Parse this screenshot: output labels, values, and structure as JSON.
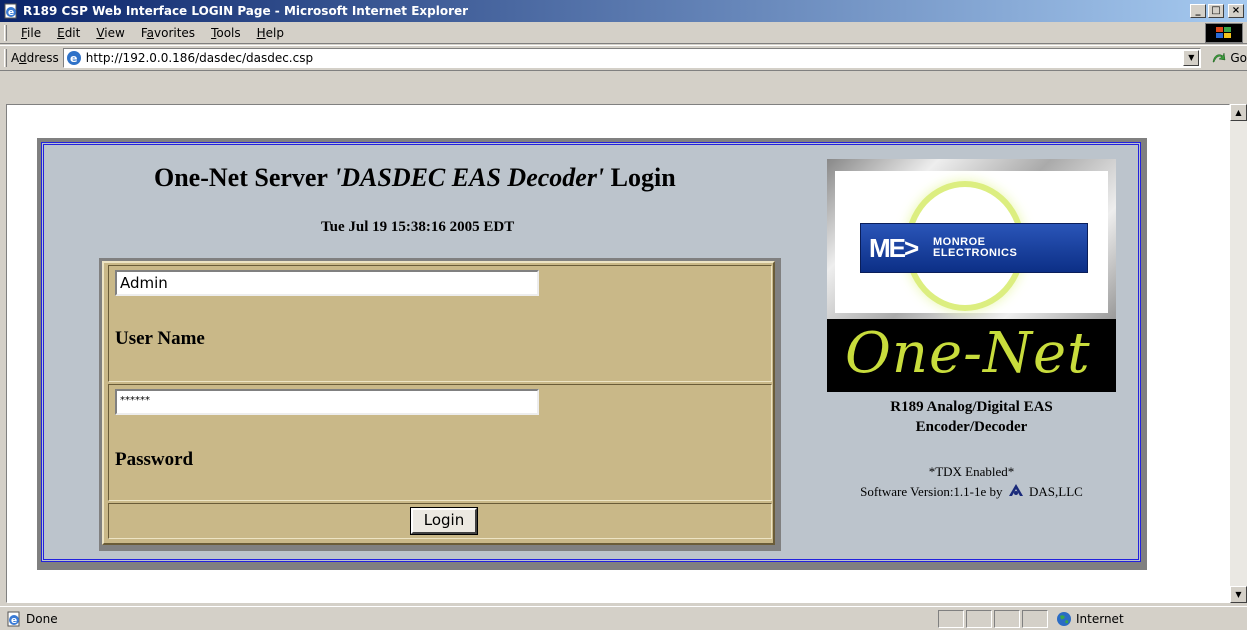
{
  "window": {
    "title": "R189 CSP Web Interface LOGIN Page - Microsoft Internet Explorer",
    "minimize": "_",
    "maximize": "□",
    "close": "×"
  },
  "menu": {
    "items": [
      {
        "key": "F",
        "rest": "ile"
      },
      {
        "key": "E",
        "rest": "dit"
      },
      {
        "key": "V",
        "rest": "iew"
      },
      {
        "pre": "F",
        "key": "a",
        "rest": "vorites"
      },
      {
        "key": "T",
        "rest": "ools"
      },
      {
        "key": "H",
        "rest": "elp"
      }
    ]
  },
  "address": {
    "label_pre": "A",
    "label_key": "d",
    "label_rest": "dress",
    "url": "http://192.0.0.186/dasdec/dasdec.csp",
    "go_label": "Go"
  },
  "page": {
    "heading_plain": "One-Net Server ",
    "heading_italic": "'DASDEC EAS Decoder'",
    "heading_end": " Login",
    "datetime": "Tue Jul 19 15:38:16 2005 EDT",
    "form": {
      "username_value": "Admin",
      "username_label": "User Name",
      "password_value": "******",
      "password_label": "Password",
      "login_label": "Login"
    },
    "logo": {
      "monroe_line1": "MONROE",
      "monroe_line2": "ELECTRONICS",
      "me_mark": "ME>",
      "onenet": "One-Net"
    },
    "product_line1": "R189 Analog/Digital EAS",
    "product_line2": "Encoder/Decoder",
    "tdx": "*TDX Enabled*",
    "version_text": "Software Version:1.1-1e  by",
    "vendor": "DAS,LLC"
  },
  "status": {
    "text": "Done",
    "zone": "Internet"
  }
}
